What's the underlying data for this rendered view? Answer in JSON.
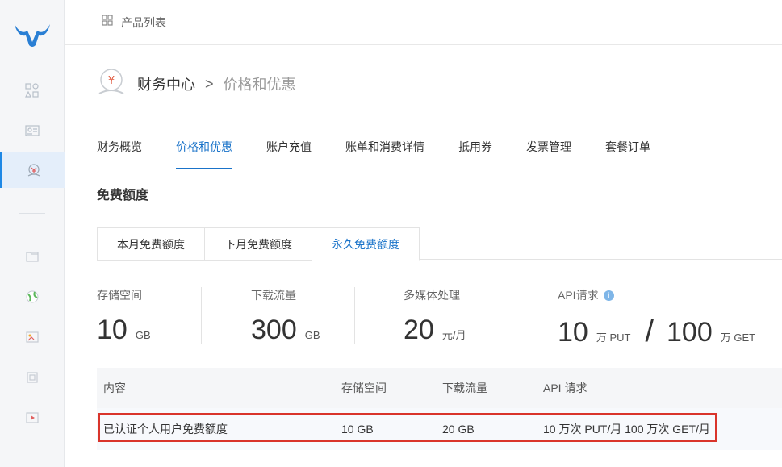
{
  "topbar": {
    "label": "产品列表",
    "icon": "grid-icon"
  },
  "breadcrumb": {
    "title": "财务中心",
    "separator": ">",
    "current": "价格和优惠",
    "icon": "yuan-coin-icon"
  },
  "tabs": [
    {
      "label": "财务概览",
      "active": false
    },
    {
      "label": "价格和优惠",
      "active": true
    },
    {
      "label": "账户充值",
      "active": false
    },
    {
      "label": "账单和消费详情",
      "active": false
    },
    {
      "label": "抵用券",
      "active": false
    },
    {
      "label": "发票管理",
      "active": false
    },
    {
      "label": "套餐订单",
      "active": false
    }
  ],
  "section_title": "免费额度",
  "subtabs": [
    {
      "label": "本月免费额度",
      "active": false
    },
    {
      "label": "下月免费额度",
      "active": false
    },
    {
      "label": "永久免费额度",
      "active": true
    }
  ],
  "stats": {
    "storage": {
      "label": "存储空间",
      "value": "10",
      "unit": "GB"
    },
    "download": {
      "label": "下载流量",
      "value": "300",
      "unit": "GB"
    },
    "media": {
      "label": "多媒体处理",
      "value": "20",
      "unit": "元/月"
    },
    "api": {
      "label": "API请求",
      "put_value": "10",
      "put_unit": "万 PUT",
      "slash": "/",
      "get_value": "100",
      "get_unit": "万 GET",
      "info": "i"
    }
  },
  "table": {
    "headers": [
      "内容",
      "存储空间",
      "下载流量",
      "API 请求"
    ],
    "rows": [
      [
        "已认证个人用户免费额度",
        "10 GB",
        "20 GB",
        "10 万次 PUT/月 100 万次 GET/月"
      ]
    ]
  },
  "colors": {
    "accent": "#1a73c9",
    "highlight": "#d9342b",
    "logo": "#2a7fd4"
  }
}
